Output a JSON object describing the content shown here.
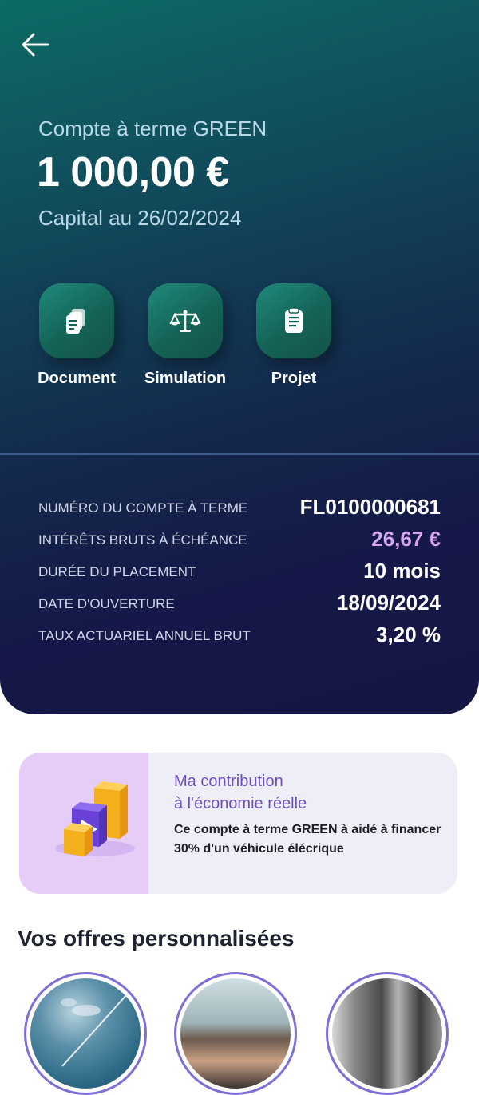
{
  "header": {
    "back_icon": "arrow-left-icon",
    "account_name": "Compte à terme GREEN",
    "amount": "1 000,00 €",
    "capital_date": "Capital au 26/02/2024"
  },
  "actions": [
    {
      "label": "Document",
      "icon": "documents-icon"
    },
    {
      "label": "Simulation",
      "icon": "scale-icon"
    },
    {
      "label": "Projet",
      "icon": "clipboard-icon"
    }
  ],
  "details": [
    {
      "label": "NUMÉRO DU COMPTE À TERME",
      "value": "FL0100000681"
    },
    {
      "label": "INTÉRÊTS BRUTS À ÉCHÉANCE",
      "value": "26,67 €"
    },
    {
      "label": "DURÉE DU PLACEMENT",
      "value": "10 mois"
    },
    {
      "label": "DATE D'OUVERTURE",
      "value": "18/09/2024"
    },
    {
      "label": "TAUX ACTUARIEL ANNUEL BRUT",
      "value": "3,20 %"
    }
  ],
  "contribution": {
    "title_line1": "Ma contribution",
    "title_line2": "à l'économie réelle",
    "body": "Ce compte à terme GREEN à aidé à financer 30% d'un véhicule élécrique",
    "illustration": "growth-blocks-play-icon"
  },
  "offers": {
    "title": "Vos offres personnalisées"
  },
  "colors": {
    "accent_interest": "#d7a6f1",
    "contribution_title": "#6e4fc2",
    "hero_gradient_start": "#0c6b64",
    "hero_gradient_end": "#161643"
  }
}
